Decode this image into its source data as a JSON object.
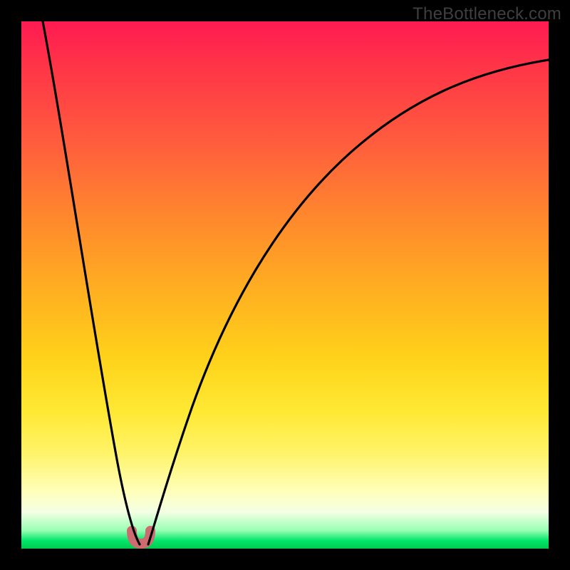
{
  "watermark": "TheBottleneck.com",
  "chart_data": {
    "type": "line",
    "title": "",
    "xlabel": "",
    "ylabel": "",
    "xlim": [
      0,
      100
    ],
    "ylim": [
      0,
      100
    ],
    "note": "Bottleneck-percentage style chart. Y≈0 at the optimal point (~x=22) where the two curves meet; values rise sharply to both sides. No axis ticks or labels are shown.",
    "series": [
      {
        "name": "left-branch",
        "x": [
          0,
          2,
          4,
          6,
          8,
          10,
          12,
          14,
          16,
          18,
          20,
          21,
          22
        ],
        "values": [
          100,
          91,
          82,
          73,
          64,
          55,
          46,
          37,
          28,
          19,
          10,
          5,
          1
        ]
      },
      {
        "name": "right-branch",
        "x": [
          24,
          26,
          28,
          30,
          34,
          38,
          42,
          46,
          50,
          55,
          60,
          65,
          70,
          75,
          80,
          85,
          90,
          95,
          100
        ],
        "values": [
          3,
          10,
          17,
          23,
          33,
          41,
          48,
          54,
          59,
          65,
          70,
          74,
          77,
          80,
          82.5,
          85,
          87,
          88.5,
          90
        ]
      }
    ],
    "valley_marker": {
      "x": 22,
      "y": 1,
      "color": "#cc6b70"
    }
  },
  "colors": {
    "curve": "#000000",
    "valley_blob": "#cc6b70"
  }
}
